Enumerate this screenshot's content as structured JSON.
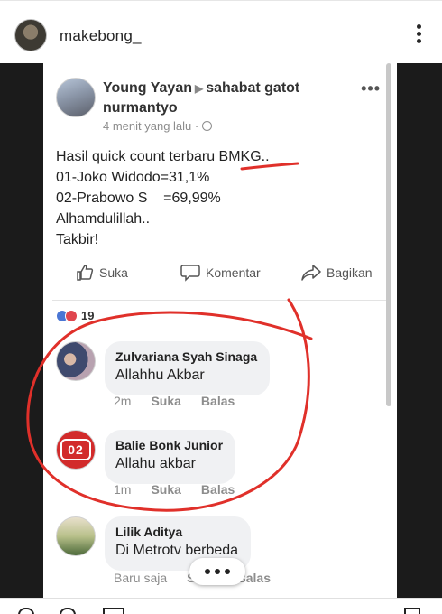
{
  "instagram": {
    "username": "makebong_"
  },
  "post": {
    "author": "Young Yayan",
    "target": "sahabat gatot nurmantyo",
    "time": "4 menit yang lalu",
    "body_lines": [
      "Hasil quick count terbaru BMKG..",
      "01-Joko Widodo=31,1%",
      "02-Prabowo S    =69,99%",
      "Alhamdulillah..",
      "Takbir!"
    ],
    "actions": {
      "like": "Suka",
      "comment": "Komentar",
      "share": "Bagikan"
    },
    "reaction_count": "19"
  },
  "comments": [
    {
      "name": "Zulvariana Syah Sinaga",
      "text": "Allahhu Akbar",
      "time": "2m",
      "like": "Suka",
      "reply": "Balas"
    },
    {
      "name": "Balie Bonk Junior",
      "text": "Allahu akbar",
      "time": "1m",
      "like": "Suka",
      "reply": "Balas",
      "avatar_badge": "02"
    },
    {
      "name": "Lilik Aditya",
      "text": "Di Metrotv berbeda",
      "time": "Baru saja",
      "like": "Suka",
      "reply": "Balas"
    }
  ],
  "colors": {
    "annotation_red": "#e0302a",
    "photo_background": "#1b1b1b",
    "bubble": "#f0f1f3"
  }
}
